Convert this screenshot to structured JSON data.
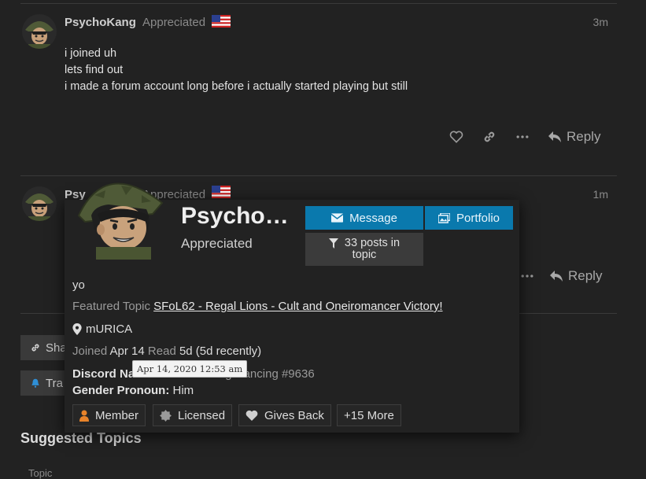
{
  "post1": {
    "username": "PsychoKang",
    "user_title": "Appreciated",
    "time": "3m",
    "body": [
      "i joined uh",
      "lets find out",
      "i made a forum account long before i actually started playing but still"
    ],
    "reply_label": "Reply"
  },
  "post2": {
    "username": "Psy",
    "user_title": "Appreciated",
    "time": "1m",
    "reply_label": "Reply"
  },
  "topic_buttons": {
    "share_label": "Sha",
    "track_label": "Tra"
  },
  "user_card": {
    "name": "Psycho…",
    "title": "Appreciated",
    "message_label": "Message",
    "portfolio_label": "Portfolio",
    "posts_label_line1": "33 posts in",
    "posts_label_line2": "topic",
    "bio": "yo",
    "featured_topic_label": "Featured Topic",
    "featured_topic": "SFoL62 - Regal Lions - Cult and Oneiromancer Victory!",
    "location": "mURICA",
    "joined_label": "Joined",
    "joined_value": "Apr 14",
    "read_label": "Read",
    "read_value": "5d (5d recently)",
    "discord_label": "Discord Name:",
    "discord_value": "CEO of Smug Dancing #9636",
    "pronoun_label": "Gender Pronoun:",
    "pronoun_value": "Him",
    "badges": [
      "Member",
      "Licensed",
      "Gives Back",
      "+15 More"
    ],
    "tooltip": "Apr 14, 2020 12:53 am",
    "colors": {
      "primary_button": "#0a79ad",
      "member_icon": "#e8832a"
    }
  },
  "suggested": {
    "title": "Suggested Topics",
    "column_topic": "Topic"
  }
}
